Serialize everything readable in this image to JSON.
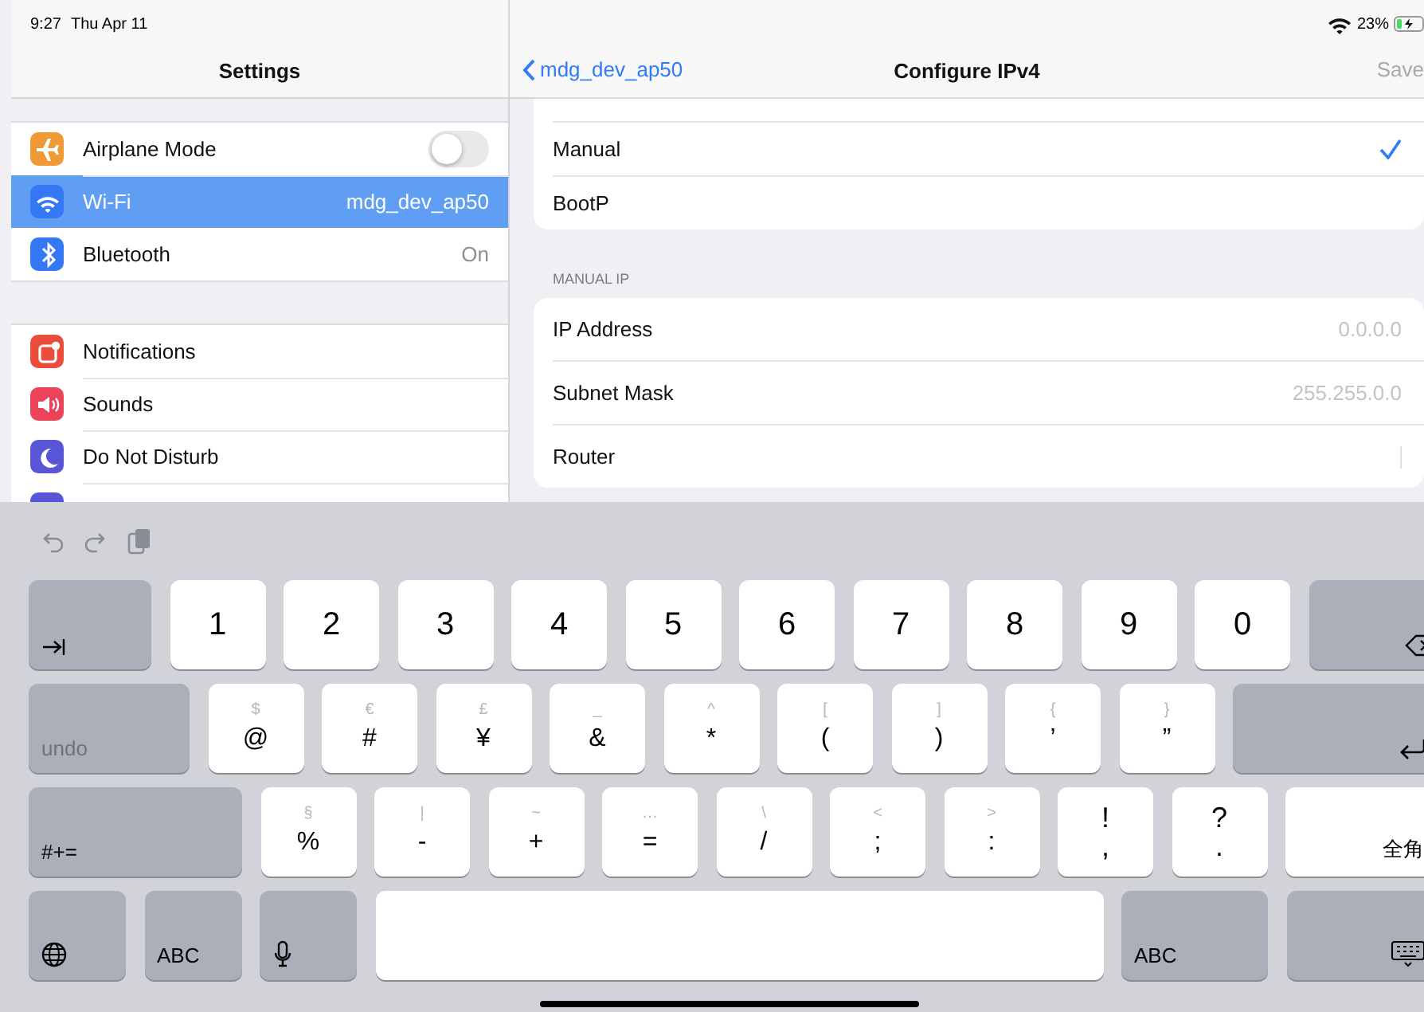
{
  "sidebar": {
    "status": {
      "time": "9:27",
      "date": "Thu Apr 11"
    },
    "title": "Settings",
    "groups": [
      [
        {
          "label": "Airplane Mode",
          "kind": "toggle",
          "on": false,
          "selected": false,
          "color": "#f09a37"
        },
        {
          "label": "Wi-Fi",
          "kind": "value",
          "value": "mdg_dev_ap50",
          "selected": true,
          "color": "#3478f6"
        },
        {
          "label": "Bluetooth",
          "kind": "value",
          "value": "On",
          "selected": false,
          "color": "#3478f6"
        }
      ],
      [
        {
          "label": "Notifications",
          "kind": "plain",
          "selected": false,
          "color": "#eb4d3d"
        },
        {
          "label": "Sounds",
          "kind": "plain",
          "selected": false,
          "color": "#eb445a"
        },
        {
          "label": "Do Not Disturb",
          "kind": "plain",
          "selected": false,
          "color": "#5856d6"
        },
        {
          "kind": "plain",
          "selected": false,
          "color": "#5856d6"
        }
      ]
    ]
  },
  "detail": {
    "status": {
      "battery": "23%"
    },
    "nav": {
      "back": "mdg_dev_ap50",
      "title": "Configure IPv4",
      "action": "Save",
      "action_disabled": true
    },
    "method_options": [
      {
        "label": "Manual",
        "selected": true
      },
      {
        "label": "BootP",
        "selected": false
      }
    ],
    "manual_ip": {
      "header": "MANUAL IP",
      "fields": [
        {
          "label": "IP Address",
          "placeholder": "0.0.0.0",
          "focused": false
        },
        {
          "label": "Subnet Mask",
          "placeholder": "255.255.0.0",
          "focused": false
        },
        {
          "label": "Router",
          "focused": true
        }
      ]
    }
  },
  "keyboard": {
    "rows": [
      [
        {
          "kind": "tab"
        },
        {
          "kind": "char",
          "main": "1"
        },
        {
          "kind": "char",
          "main": "2"
        },
        {
          "kind": "char",
          "main": "3"
        },
        {
          "kind": "char",
          "main": "4"
        },
        {
          "kind": "char",
          "main": "5"
        },
        {
          "kind": "char",
          "main": "6"
        },
        {
          "kind": "char",
          "main": "7"
        },
        {
          "kind": "char",
          "main": "8"
        },
        {
          "kind": "char",
          "main": "9"
        },
        {
          "kind": "char",
          "main": "0"
        },
        {
          "kind": "delete"
        }
      ],
      [
        {
          "kind": "undo",
          "label": "undo"
        },
        {
          "kind": "char",
          "alt": "$",
          "main": "@"
        },
        {
          "kind": "char",
          "alt": "€",
          "main": "#"
        },
        {
          "kind": "char",
          "alt": "£",
          "main": "¥"
        },
        {
          "kind": "char",
          "alt": "_",
          "main": "&"
        },
        {
          "kind": "char",
          "alt": "^",
          "main": "*"
        },
        {
          "kind": "char",
          "alt": "[",
          "main": "("
        },
        {
          "kind": "char",
          "alt": "]",
          "main": ")"
        },
        {
          "kind": "char",
          "alt": "{",
          "main": "’"
        },
        {
          "kind": "char",
          "alt": "}",
          "main": "”"
        },
        {
          "kind": "return"
        }
      ],
      [
        {
          "kind": "shift",
          "label": "#+="
        },
        {
          "kind": "char",
          "alt": "§",
          "main": "%"
        },
        {
          "kind": "char",
          "alt": "|",
          "main": "-"
        },
        {
          "kind": "char",
          "alt": "~",
          "main": "+"
        },
        {
          "kind": "char",
          "alt": "…",
          "main": "="
        },
        {
          "kind": "char",
          "alt": "\\",
          "main": "/"
        },
        {
          "kind": "char",
          "alt": "<",
          "main": ";"
        },
        {
          "kind": "char",
          "alt": ">",
          "main": ":"
        },
        {
          "kind": "dual",
          "alt": "!",
          "main": ","
        },
        {
          "kind": "dual",
          "alt": "?",
          "main": "."
        },
        {
          "kind": "width",
          "label": "全角"
        }
      ],
      [
        {
          "kind": "globe"
        },
        {
          "kind": "abc",
          "label": "ABC"
        },
        {
          "kind": "mic"
        },
        {
          "kind": "space"
        },
        {
          "kind": "abc",
          "label": "ABC"
        },
        {
          "kind": "hide"
        }
      ]
    ]
  }
}
